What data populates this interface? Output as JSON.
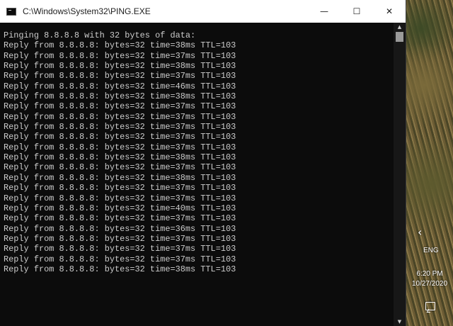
{
  "window": {
    "title": "C:\\Windows\\System32\\PING.EXE",
    "minimize_glyph": "—",
    "maximize_glyph": "☐",
    "close_glyph": "✕"
  },
  "console": {
    "lines": [
      "Pinging 8.8.8.8 with 32 bytes of data:",
      "Reply from 8.8.8.8: bytes=32 time=38ms TTL=103",
      "Reply from 8.8.8.8: bytes=32 time=37ms TTL=103",
      "Reply from 8.8.8.8: bytes=32 time=38ms TTL=103",
      "Reply from 8.8.8.8: bytes=32 time=37ms TTL=103",
      "Reply from 8.8.8.8: bytes=32 time=46ms TTL=103",
      "Reply from 8.8.8.8: bytes=32 time=38ms TTL=103",
      "Reply from 8.8.8.8: bytes=32 time=37ms TTL=103",
      "Reply from 8.8.8.8: bytes=32 time=37ms TTL=103",
      "Reply from 8.8.8.8: bytes=32 time=37ms TTL=103",
      "Reply from 8.8.8.8: bytes=32 time=37ms TTL=103",
      "Reply from 8.8.8.8: bytes=32 time=37ms TTL=103",
      "Reply from 8.8.8.8: bytes=32 time=38ms TTL=103",
      "Reply from 8.8.8.8: bytes=32 time=37ms TTL=103",
      "Reply from 8.8.8.8: bytes=32 time=38ms TTL=103",
      "Reply from 8.8.8.8: bytes=32 time=37ms TTL=103",
      "Reply from 8.8.8.8: bytes=32 time=37ms TTL=103",
      "Reply from 8.8.8.8: bytes=32 time=40ms TTL=103",
      "Reply from 8.8.8.8: bytes=32 time=37ms TTL=103",
      "Reply from 8.8.8.8: bytes=32 time=36ms TTL=103",
      "Reply from 8.8.8.8: bytes=32 time=37ms TTL=103",
      "Reply from 8.8.8.8: bytes=32 time=37ms TTL=103",
      "Reply from 8.8.8.8: bytes=32 time=37ms TTL=103",
      "Reply from 8.8.8.8: bytes=32 time=38ms TTL=103"
    ]
  },
  "scrollbar": {
    "up_glyph": "▲",
    "down_glyph": "▼"
  },
  "taskbar": {
    "chevron_glyph": "‹",
    "language": "ENG",
    "time": "6:20 PM",
    "date": "10/27/2020"
  },
  "colors": {
    "console_background": "#0c0c0c",
    "console_text": "#cccccc",
    "titlebar_background": "#ffffff"
  },
  "icons": [
    "cmd-app-icon",
    "minimize-icon",
    "maximize-icon",
    "close-icon",
    "chevron-left-icon",
    "notification-icon"
  ]
}
